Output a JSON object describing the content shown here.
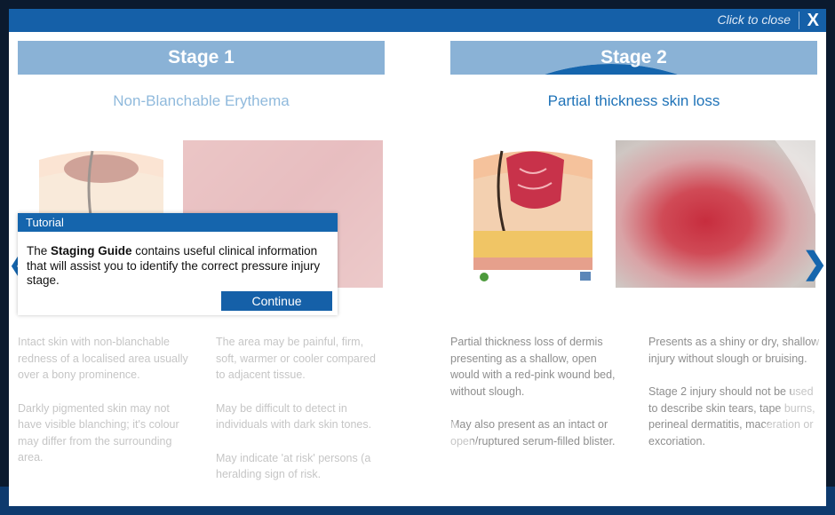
{
  "modal": {
    "close_text": "Click to close",
    "close_x": "X"
  },
  "stages": [
    {
      "header": "Stage 1",
      "subtitle": "Non-Blanchable Erythema",
      "desc_left": [
        "Intact skin with non-blanchable redness of a localised area usually over a bony prominence.",
        "Darkly pigmented skin may not have visible blanching; it's colour may differ from the surrounding area."
      ],
      "desc_right": [
        "The area may be painful, firm, soft, warmer or cooler compared to adjacent tissue.",
        "May be difficult to detect in individuals with dark skin tones.",
        "May indicate 'at risk' persons (a heralding sign of risk."
      ]
    },
    {
      "header": "Stage 2",
      "subtitle": "Partial thickness skin loss",
      "desc_left": [
        "Partial thickness loss of dermis presenting as a shallow, open would with a red-pink wound bed, without slough.",
        "May also present as an intact or open/ruptured serum-filled blister."
      ],
      "desc_right": [
        "Presents as a shiny or dry, shallow injury without slough or bruising.",
        "Stage 2 injury should not be used to describe skin tears, tape burns, perineal dermatitis, maceration or excoriation."
      ]
    }
  ],
  "tutorial": {
    "title": "Tutorial",
    "text_before": "The ",
    "text_bold": "Staging Guide",
    "text_after": " contains useful clinical information that will assist you to identify the correct pressure injury stage.",
    "button": "Continue"
  },
  "nav": {
    "next": "❯",
    "prev": "❮"
  },
  "colors": {
    "accent": "#1565ad",
    "subtitle": "#1f73b8",
    "overlay_backdrop": "#0b1a2e"
  }
}
